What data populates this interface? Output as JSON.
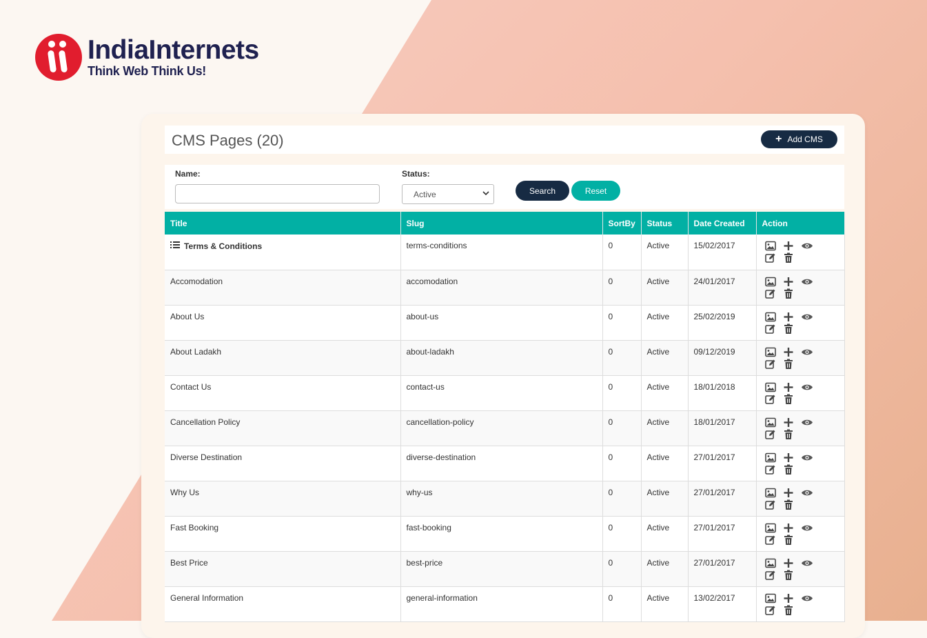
{
  "brand": {
    "name": "IndiaInternets",
    "tagline": "Think Web Think Us!"
  },
  "header": {
    "title": "CMS Pages (20)",
    "add_label": "Add CMS"
  },
  "filters": {
    "name_label": "Name:",
    "name_value": "",
    "status_label": "Status:",
    "status_value": "Active",
    "search_label": "Search",
    "reset_label": "Reset"
  },
  "table": {
    "columns": [
      "Title",
      "Slug",
      "SortBy",
      "Status",
      "Date Created",
      "Action"
    ],
    "rows": [
      {
        "title": "Terms & Conditions",
        "slug": "terms-conditions",
        "sortby": "0",
        "status": "Active",
        "date": "15/02/2017"
      },
      {
        "title": "Accomodation",
        "slug": "accomodation",
        "sortby": "0",
        "status": "Active",
        "date": "24/01/2017"
      },
      {
        "title": "About Us",
        "slug": "about-us",
        "sortby": "0",
        "status": "Active",
        "date": "25/02/2019"
      },
      {
        "title": "About Ladakh",
        "slug": "about-ladakh",
        "sortby": "0",
        "status": "Active",
        "date": "09/12/2019"
      },
      {
        "title": "Contact Us",
        "slug": "contact-us",
        "sortby": "0",
        "status": "Active",
        "date": "18/01/2018"
      },
      {
        "title": "Cancellation Policy",
        "slug": "cancellation-policy",
        "sortby": "0",
        "status": "Active",
        "date": "18/01/2017"
      },
      {
        "title": "Diverse Destination",
        "slug": "diverse-destination",
        "sortby": "0",
        "status": "Active",
        "date": "27/01/2017"
      },
      {
        "title": "Why Us",
        "slug": "why-us",
        "sortby": "0",
        "status": "Active",
        "date": "27/01/2017"
      },
      {
        "title": "Fast Booking",
        "slug": "fast-booking",
        "sortby": "0",
        "status": "Active",
        "date": "27/01/2017"
      },
      {
        "title": "Best Price",
        "slug": "best-price",
        "sortby": "0",
        "status": "Active",
        "date": "27/01/2017"
      },
      {
        "title": "General Information",
        "slug": "general-information",
        "sortby": "0",
        "status": "Active",
        "date": "13/02/2017"
      }
    ]
  },
  "colors": {
    "teal": "#02b0a4",
    "navy": "#172b43",
    "brand_red": "#e11d2e",
    "brand_navy": "#1f2150",
    "status_active": "#2e8b2e"
  },
  "icons": {
    "row_actions": [
      "image-icon",
      "plus-icon",
      "eye-icon",
      "edit-icon",
      "trash-icon"
    ],
    "first_row": "list-icon"
  }
}
